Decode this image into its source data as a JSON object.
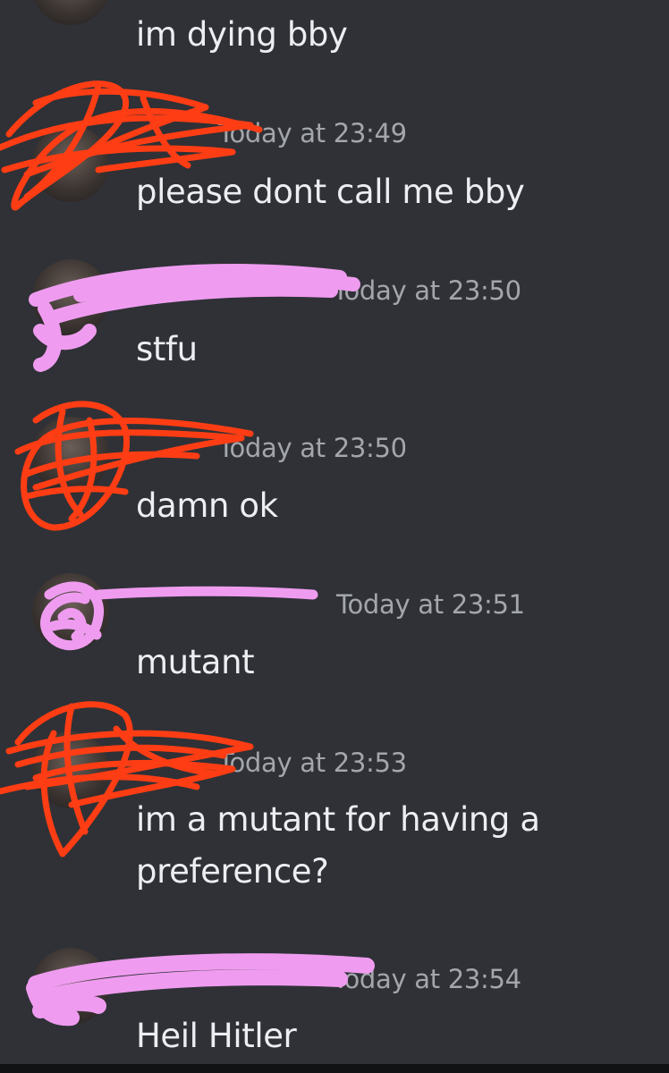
{
  "messages": [
    {
      "timestamp": "",
      "text": "im dying bby"
    },
    {
      "timestamp": "Today at 23:49",
      "text": "please dont call me bby"
    },
    {
      "timestamp": "Today at 23:50",
      "text": "stfu"
    },
    {
      "timestamp": "Today at 23:50",
      "text": "damn ok"
    },
    {
      "timestamp": "Today at 23:51",
      "text": "mutant"
    },
    {
      "timestamp": "Today at 23:53",
      "text": "im a mutant for having a\npreference?"
    },
    {
      "timestamp": "Today at 23:54",
      "text": "Heil Hitler"
    }
  ],
  "colors": {
    "background": "#2f3136",
    "text": "#eceef1",
    "timestamp": "#a3a6ab",
    "redaction_red": "#ff3d14",
    "redaction_pink": "#ef9cf0"
  }
}
